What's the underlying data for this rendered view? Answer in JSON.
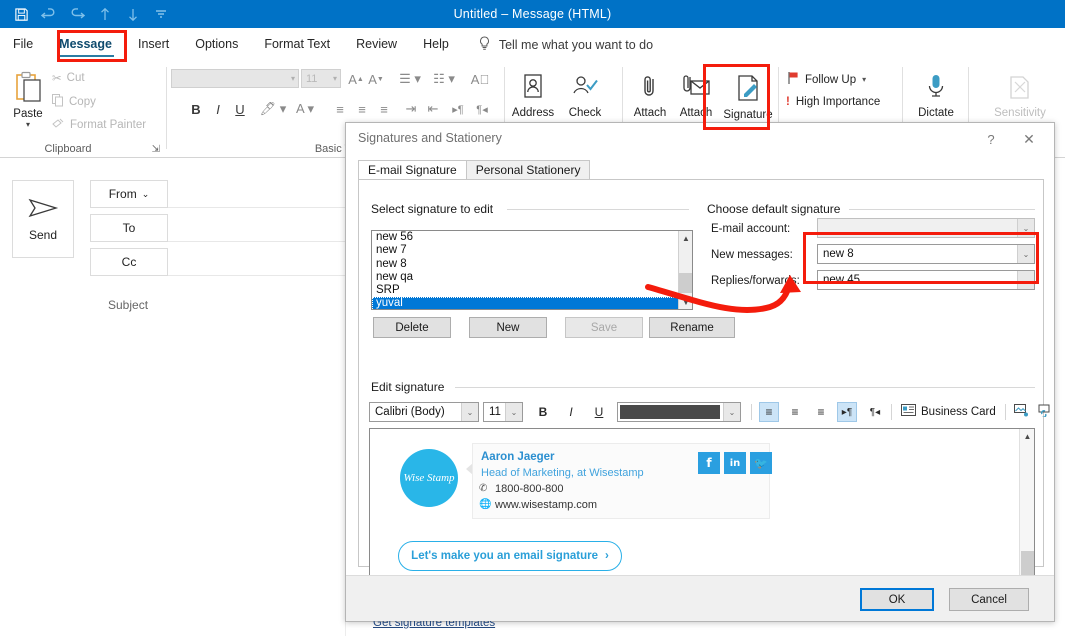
{
  "titlebar": {
    "title": "Untitled  –  Message (HTML)",
    "quick_access": [
      {
        "name": "save-icon",
        "label": "Save"
      },
      {
        "name": "undo-icon",
        "label": "Undo"
      },
      {
        "name": "redo-icon",
        "label": "Redo"
      },
      {
        "name": "previous-item-icon",
        "label": "Previous Item"
      },
      {
        "name": "next-item-icon",
        "label": "Next Item"
      },
      {
        "name": "customize-quick-access-toolbar-icon",
        "label": "Customize Quick Access Toolbar"
      }
    ]
  },
  "ribbon": {
    "tabs": [
      {
        "label": "File",
        "active": false
      },
      {
        "label": "Message",
        "active": true
      },
      {
        "label": "Insert",
        "active": false
      },
      {
        "label": "Options",
        "active": false
      },
      {
        "label": "Format Text",
        "active": false
      },
      {
        "label": "Review",
        "active": false
      },
      {
        "label": "Help",
        "active": false
      }
    ],
    "tell_me": "Tell me what you want to do",
    "groups": {
      "clipboard": {
        "label": "Clipboard",
        "paste": "Paste",
        "cut": "Cut",
        "copy": "Copy",
        "format_painter": "Format Painter"
      },
      "basic_text": {
        "label": "Basic Te",
        "font_name": "",
        "font_size": "11"
      },
      "names": {
        "address_book": "Address",
        "check_names": "Check"
      },
      "include": {
        "attach_file": "Attach",
        "attach_item": "Attach",
        "signature": "Signature"
      },
      "tags": {
        "follow_up": "Follow Up",
        "high_importance": "High Importance"
      },
      "voice": {
        "dictate": "Dictate"
      },
      "sensitivity": {
        "label": "Sensitivity"
      }
    }
  },
  "compose": {
    "send": "Send",
    "from": "From",
    "to": "To",
    "cc": "Cc",
    "subject": "Subject"
  },
  "dialog": {
    "title": "Signatures and Stationery",
    "help_glyph": "?",
    "close_glyph": "✕",
    "tabs": [
      {
        "label": "E-mail Signature",
        "active": true
      },
      {
        "label": "Personal Stationery",
        "active": false
      }
    ],
    "select_signature": {
      "caption": "Select signature to edit",
      "items": [
        "new 56",
        "new 7",
        "new 8",
        "new qa",
        "SRP",
        "yuval"
      ],
      "selected": "yuval",
      "buttons": [
        {
          "label": "Delete",
          "disabled": false
        },
        {
          "label": "New",
          "disabled": false
        },
        {
          "label": "Save",
          "disabled": true
        },
        {
          "label": "Rename",
          "disabled": false
        }
      ]
    },
    "default_signature": {
      "caption": "Choose default signature",
      "email_account_label": "E-mail account:",
      "email_account_value": "",
      "new_messages_label": "New messages:",
      "new_messages_value": "new 8",
      "replies_label": "Replies/forwards:",
      "replies_value": "new 45"
    },
    "edit_signature": {
      "caption": "Edit signature",
      "font_name": "Calibri (Body)",
      "font_size": "11",
      "bold": "B",
      "italic": "I",
      "underline": "U",
      "font_color": "#4a4a4a",
      "align_left": "align-left",
      "align_center": "align-center",
      "align_right": "align-right",
      "ltr": "left-to-right",
      "rtl": "right-to-left",
      "business_card": "Business Card",
      "picture": "picture",
      "hyperlink": "hyperlink"
    },
    "signature_preview": {
      "logo_text": "Wise Stamp",
      "name": "Aaron Jaeger",
      "role": "Head of Marketing, at Wisestamp",
      "phone": "1800-800-800",
      "website": "www.wisestamp.com",
      "social": [
        {
          "name": "facebook-icon",
          "glyph": "f"
        },
        {
          "name": "linkedin-icon",
          "glyph": "in"
        },
        {
          "name": "twitter-icon",
          "glyph": "🐦"
        }
      ],
      "cta": "Let's make you an email signature",
      "cta_arrow": "›"
    },
    "get_templates": "Get signature templates",
    "ok": "OK",
    "cancel": "Cancel"
  },
  "annotations": {
    "highlight_color": "#f41c0c",
    "boxes": [
      "message-tab",
      "signature-button",
      "default-signature-dropdowns"
    ],
    "arrow": "points from selected signature 'yuval' to the default signature dropdowns"
  }
}
